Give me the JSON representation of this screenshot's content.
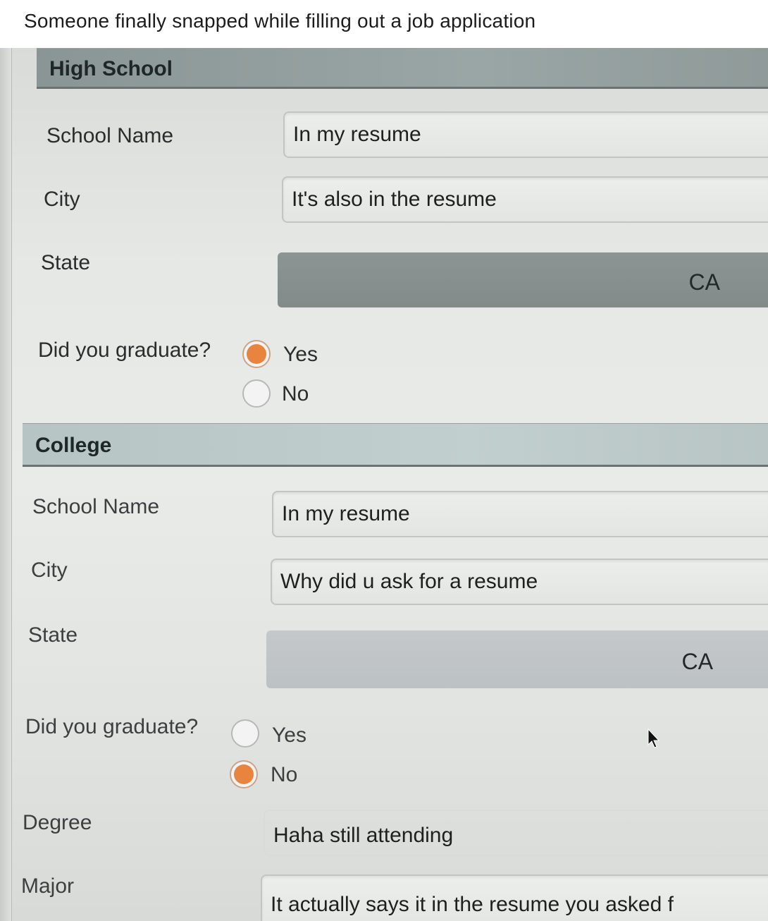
{
  "post": {
    "caption": "Someone finally snapped while filling out a job application"
  },
  "high_school": {
    "section_title": "High School",
    "school_name_label": "School Name",
    "school_name_value": "In my resume",
    "city_label": "City",
    "city_value": "It's also in the resume",
    "state_label": "State",
    "state_value": "CA",
    "graduate_label": "Did you graduate?",
    "yes_label": "Yes",
    "no_label": "No",
    "graduated": "Yes"
  },
  "college": {
    "section_title": "College",
    "school_name_label": "School Name",
    "school_name_value": "In my resume",
    "city_label": "City",
    "city_value": "Why did u ask for a resume",
    "state_label": "State",
    "state_value": "CA",
    "graduate_label": "Did you graduate?",
    "yes_label": "Yes",
    "no_label": "No",
    "graduated": "No",
    "degree_label": "Degree",
    "degree_value": "Haha still attending",
    "major_label": "Major",
    "major_value": "It actually says it in the resume you asked f"
  },
  "colors": {
    "radio_selected": "#e8843e",
    "section_header_dark": "#8a9595",
    "section_header_light": "#b6c4c4"
  }
}
